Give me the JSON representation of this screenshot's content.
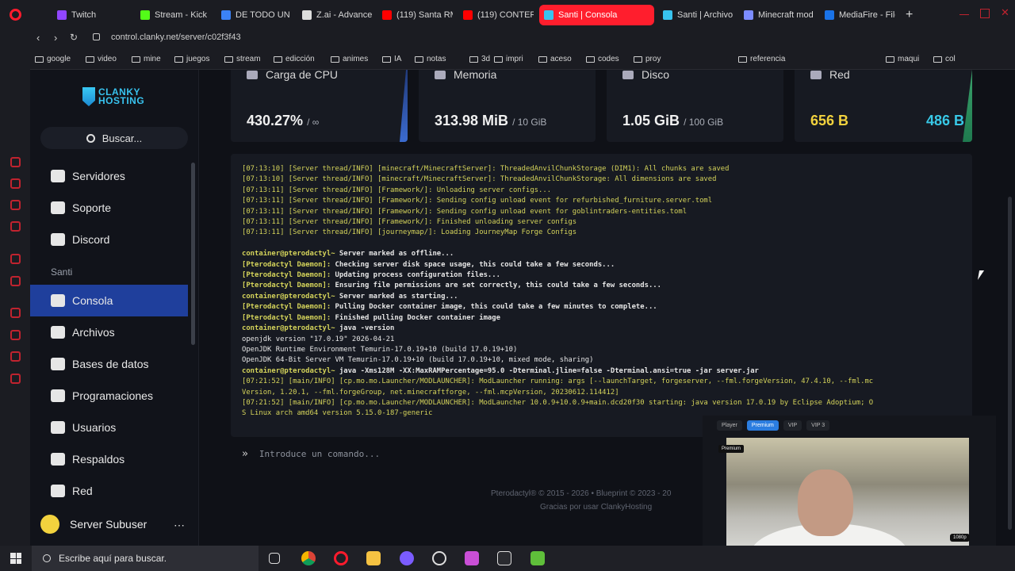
{
  "browser": {
    "tabs": [
      {
        "label": "Twitch",
        "color": "#9146ff"
      },
      {
        "label": "Stream - Kick",
        "color": "#53fc18"
      },
      {
        "label": "DE TODO UN",
        "color": "#3b82f6"
      },
      {
        "label": "Z.ai - Advance",
        "color": "#dddddd"
      },
      {
        "label": "(119) Santa RM",
        "color": "#ff0000"
      },
      {
        "label": "(119) CONTER",
        "color": "#ff0000"
      },
      {
        "label": "Santi | Consola",
        "color": "#38c3ef"
      },
      {
        "label": "Santi | Archivo",
        "color": "#38c3ef"
      },
      {
        "label": "Minecraft mod",
        "color": "#7c8cff"
      },
      {
        "label": "MediaFire - File",
        "color": "#1a73e8"
      }
    ],
    "url": "control.clanky.net/server/c02f3f43",
    "bookmarks": [
      "google",
      "video",
      "mine",
      "juegos",
      "stream",
      "edicción",
      "animes",
      "IA",
      "notas",
      "3d",
      "impri",
      "aceso",
      "codes",
      "proy",
      "referencia",
      "maqui",
      "col"
    ]
  },
  "sidebar": {
    "logo_line1": "CLANKY",
    "logo_line2": "HOSTING",
    "search_placeholder": "Buscar...",
    "top_items": [
      {
        "label": "Servidores",
        "icon": "server-icon"
      },
      {
        "label": "Soporte",
        "icon": "lifebuoy-icon"
      },
      {
        "label": "Discord",
        "icon": "discord-icon"
      }
    ],
    "section": "Santi",
    "server_items": [
      {
        "label": "Consola",
        "icon": "terminal-icon"
      },
      {
        "label": "Archivos",
        "icon": "folder-icon"
      },
      {
        "label": "Bases de datos",
        "icon": "database-icon"
      },
      {
        "label": "Programaciones",
        "icon": "calendar-icon"
      },
      {
        "label": "Usuarios",
        "icon": "users-icon"
      },
      {
        "label": "Respaldos",
        "icon": "archive-icon"
      },
      {
        "label": "Red",
        "icon": "network-icon"
      }
    ],
    "user_label": "Server Subuser",
    "user_more": "⋯"
  },
  "stats": [
    {
      "title": "Carga de CPU",
      "value": "430.27%",
      "unit": "/ ∞"
    },
    {
      "title": "Memoria",
      "value": "313.98 MiB",
      "unit": "/ 10 GiB"
    },
    {
      "title": "Disco",
      "value": "1.05 GiB",
      "unit": "/ 100 GiB"
    },
    {
      "title": "Red",
      "value_in": "656 B",
      "value_out": "486 B"
    }
  ],
  "console": {
    "lines": [
      {
        "c": "yellow",
        "t": "[07:13:10] [Server thread/INFO] [minecraft/MinecraftServer]: ThreadedAnvilChunkStorage (DIM1): All chunks are saved"
      },
      {
        "c": "yellow",
        "t": "[07:13:10] [Server thread/INFO] [minecraft/MinecraftServer]: ThreadedAnvilChunkStorage: All dimensions are saved"
      },
      {
        "c": "yellow",
        "t": "[07:13:11] [Server thread/INFO] [Framework/]: Unloading server configs..."
      },
      {
        "c": "yellow",
        "t": "[07:13:11] [Server thread/INFO] [Framework/]: Sending config unload event for refurbished_furniture.server.toml"
      },
      {
        "c": "yellow",
        "t": "[07:13:11] [Server thread/INFO] [Framework/]: Sending config unload event for goblintraders-entities.toml"
      },
      {
        "c": "yellow",
        "t": "[07:13:11] [Server thread/INFO] [Framework/]: Finished unloading server configs"
      },
      {
        "c": "yellow",
        "t": "[07:13:11] [Server thread/INFO] [journeymap/]: Loading JourneyMap Forge Configs"
      },
      {
        "c": "white",
        "t": ""
      },
      {
        "p": "container@pterodactyl~",
        "t": " Server marked as offline..."
      },
      {
        "p": "[Pterodactyl Daemon]:",
        "t": " Checking server disk space usage, this could take a few seconds..."
      },
      {
        "p": "[Pterodactyl Daemon]:",
        "t": " Updating process configuration files..."
      },
      {
        "p": "[Pterodactyl Daemon]:",
        "t": " Ensuring file permissions are set correctly, this could take a few seconds..."
      },
      {
        "p": "container@pterodactyl~",
        "t": " Server marked as starting..."
      },
      {
        "p": "[Pterodactyl Daemon]:",
        "t": " Pulling Docker container image, this could take a few minutes to complete..."
      },
      {
        "p": "[Pterodactyl Daemon]:",
        "t": " Finished pulling Docker container image"
      },
      {
        "p": "container@pterodactyl~",
        "t": " java -version"
      },
      {
        "c": "white",
        "t": "openjdk version \"17.0.19\" 2026-04-21"
      },
      {
        "c": "white",
        "t": "OpenJDK Runtime Environment Temurin-17.0.19+10 (build 17.0.19+10)"
      },
      {
        "c": "white",
        "t": "OpenJDK 64-Bit Server VM Temurin-17.0.19+10 (build 17.0.19+10, mixed mode, sharing)"
      },
      {
        "p": "container@pterodactyl~",
        "t": " java -Xms128M -XX:MaxRAMPercentage=95.0 -Dterminal.jline=false -Dterminal.ansi=true -jar server.jar"
      },
      {
        "c": "yellow",
        "t": "[07:21:52] [main/INFO] [cp.mo.mo.Launcher/MODLAUNCHER]: ModLauncher running: args [--launchTarget, forgeserver, --fml.forgeVersion, 47.4.10, --fml.mc"
      },
      {
        "c": "yellow",
        "t": "Version, 1.20.1, --fml.forgeGroup, net.minecraftforge, --fml.mcpVersion, 20230612.114412]"
      },
      {
        "c": "yellow",
        "t": "[07:21:52] [main/INFO] [cp.mo.mo.Launcher/MODLAUNCHER]: ModLauncher 10.0.9+10.0.9+main.dcd20f30 starting: java version 17.0.19 by Eclipse Adoptium; O"
      },
      {
        "c": "yellow",
        "t": "S Linux arch amd64 version 5.15.0-187-generic"
      }
    ],
    "command_placeholder": "Introduce un comando..."
  },
  "footer": {
    "line1": "Pterodactyl® © 2015 - 2026  •  Blueprint © 2023 - 20",
    "line2": "Gracias por usar ClankyHosting"
  },
  "video_overlay": {
    "tabs": [
      "Player",
      "Premium",
      "VIP",
      "VIP 3"
    ],
    "badge": "Premium",
    "quality": "1080p"
  },
  "taskbar": {
    "search_placeholder": "Escribe aquí para buscar."
  }
}
